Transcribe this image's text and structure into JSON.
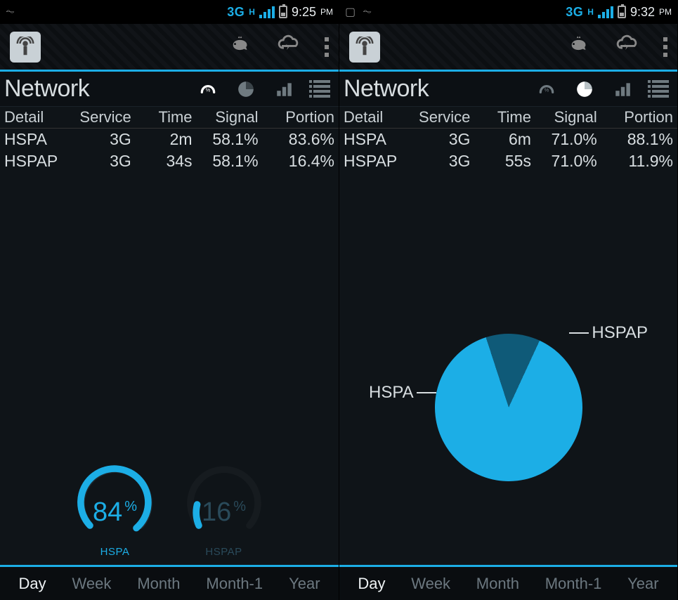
{
  "screens": [
    {
      "statusbar": {
        "network": "3G",
        "signal_strength": 4,
        "time": "9:25",
        "ampm": "PM",
        "extra_icons": [
          "plug"
        ]
      },
      "actionbar": {
        "menus": [
          "savings",
          "cloud",
          "overflow"
        ]
      },
      "section": {
        "title": "Network",
        "views": [
          "gauge",
          "pie",
          "bars",
          "list"
        ],
        "active_view": "gauge"
      },
      "columns": {
        "detail": "Detail",
        "service": "Service",
        "time": "Time",
        "signal": "Signal",
        "portion": "Portion"
      },
      "rows": [
        {
          "detail": "HSPA",
          "service": "3G",
          "time": "2m",
          "signal": "58.1%",
          "portion": "83.6%"
        },
        {
          "detail": "HSPAP",
          "service": "3G",
          "time": "34s",
          "signal": "58.1%",
          "portion": "16.4%"
        }
      ],
      "gauges": [
        {
          "label": "HSPA",
          "value": 84,
          "unit": "%"
        },
        {
          "label": "HSPAP",
          "value": 16,
          "unit": "%"
        }
      ],
      "tabs": {
        "items": [
          "Day",
          "Week",
          "Month",
          "Month-1",
          "Year"
        ],
        "active": "Day"
      }
    },
    {
      "statusbar": {
        "network": "3G",
        "signal_strength": 4,
        "time": "9:32",
        "ampm": "PM",
        "extra_icons": [
          "image",
          "plug"
        ]
      },
      "actionbar": {
        "menus": [
          "savings",
          "cloud",
          "overflow"
        ]
      },
      "section": {
        "title": "Network",
        "views": [
          "gauge",
          "pie",
          "bars",
          "list"
        ],
        "active_view": "pie"
      },
      "columns": {
        "detail": "Detail",
        "service": "Service",
        "time": "Time",
        "signal": "Signal",
        "portion": "Portion"
      },
      "rows": [
        {
          "detail": "HSPA",
          "service": "3G",
          "time": "6m",
          "signal": "71.0%",
          "portion": "88.1%"
        },
        {
          "detail": "HSPAP",
          "service": "3G",
          "time": "55s",
          "signal": "71.0%",
          "portion": "11.9%"
        }
      ],
      "pie": {
        "labels": [
          "HSPA",
          "HSPAP"
        ]
      },
      "tabs": {
        "items": [
          "Day",
          "Week",
          "Month",
          "Month-1",
          "Year"
        ],
        "active": "Day"
      }
    }
  ],
  "chart_data": [
    {
      "type": "pie",
      "title": "Network portion (gauges, Day view)",
      "categories": [
        "HSPA",
        "HSPAP"
      ],
      "values": [
        84,
        16
      ],
      "unit": "%"
    },
    {
      "type": "pie",
      "title": "Network portion (pie, Day view)",
      "categories": [
        "HSPA",
        "HSPAP"
      ],
      "values": [
        88.1,
        11.9
      ],
      "unit": "%"
    }
  ]
}
